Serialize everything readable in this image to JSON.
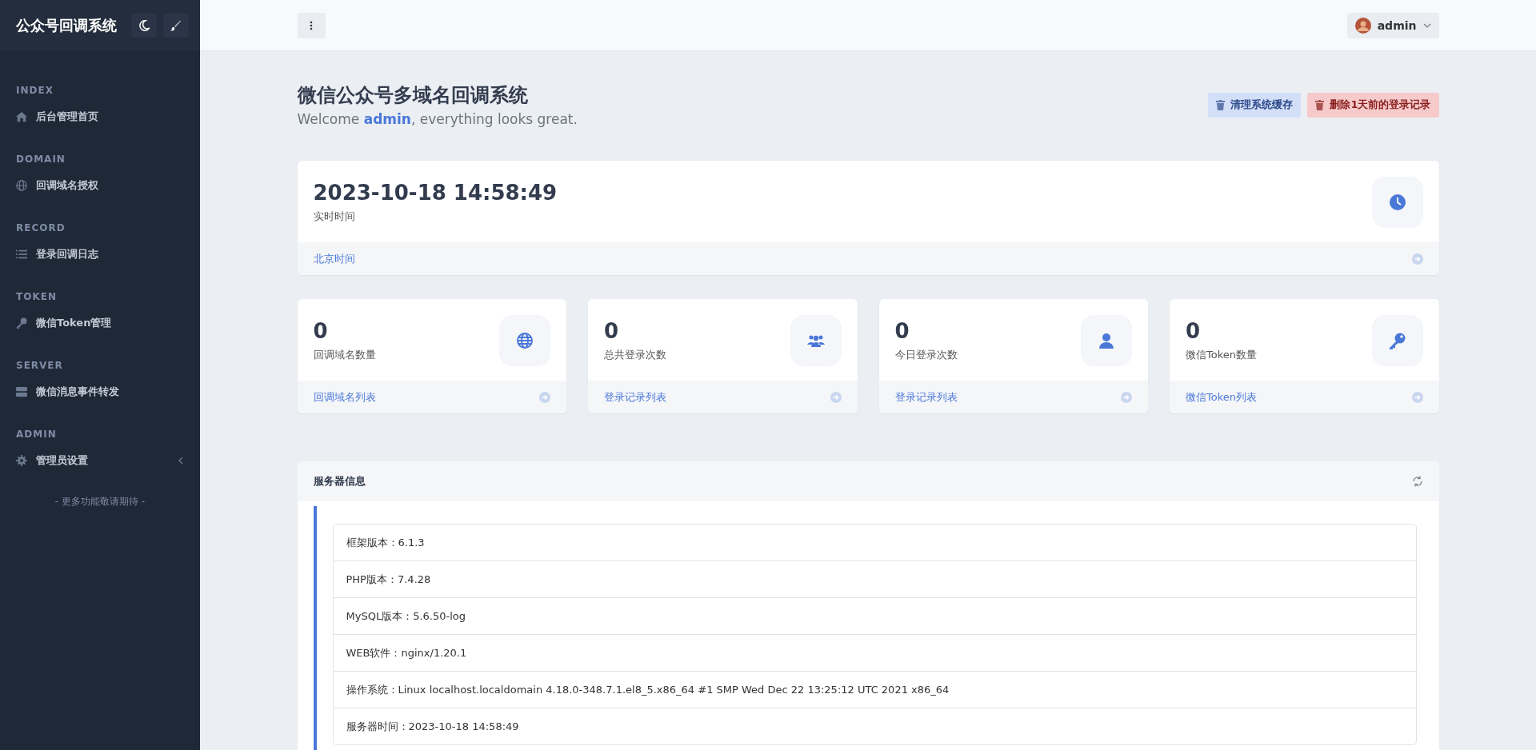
{
  "sidebar": {
    "brand": "公众号回调系统",
    "sections": [
      {
        "heading": "INDEX",
        "items": [
          {
            "label": "后台管理首页",
            "kind": "home"
          }
        ]
      },
      {
        "heading": "DOMAIN",
        "items": [
          {
            "label": "回调域名授权",
            "kind": "globe"
          }
        ]
      },
      {
        "heading": "RECORD",
        "items": [
          {
            "label": "登录回调日志",
            "kind": "list"
          }
        ]
      },
      {
        "heading": "TOKEN",
        "items": [
          {
            "label": "微信Token管理",
            "kind": "key"
          }
        ]
      },
      {
        "heading": "SERVER",
        "items": [
          {
            "label": "微信消息事件转发",
            "kind": "server"
          }
        ]
      },
      {
        "heading": "ADMIN",
        "items": [
          {
            "label": "管理员设置",
            "kind": "gear",
            "submenu": true
          }
        ]
      }
    ],
    "footer": "- 更多功能敬请期待 -"
  },
  "header": {
    "user": "admin"
  },
  "page": {
    "title": "微信公众号多域名回调系统",
    "subtitle": "Welcome **admin**, everything looks great.",
    "actions": [
      {
        "label": "清理系统缓存",
        "kind": "primary"
      },
      {
        "label": "删除1天前的登录记录",
        "kind": "danger"
      }
    ]
  },
  "clock": {
    "value": "2023-10-18 14:58:49",
    "label": "实时时间",
    "link": "北京时间"
  },
  "stats": [
    {
      "value": "0",
      "label": "回调域名数量",
      "link": "回调域名列表",
      "kind": "globe"
    },
    {
      "value": "0",
      "label": "总共登录次数",
      "link": "登录记录列表",
      "kind": "users"
    },
    {
      "value": "0",
      "label": "今日登录次数",
      "link": "登录记录列表",
      "kind": "user"
    },
    {
      "value": "0",
      "label": "微信Token数量",
      "link": "微信Token列表",
      "kind": "key"
    }
  ],
  "server": {
    "title": "服务器信息",
    "rows": [
      "框架版本：6.1.3",
      "PHP版本：7.4.28",
      "MySQL版本：5.6.50-log",
      "WEB软件：nginx/1.20.1",
      "操作系统：Linux localhost.localdomain 4.18.0-348.7.1.el8_5.x86_64 #1 SMP Wed Dec 22 13:25:12 UTC 2021 x86_64",
      "服务器时间：2023-10-18 14:58:49"
    ]
  }
}
